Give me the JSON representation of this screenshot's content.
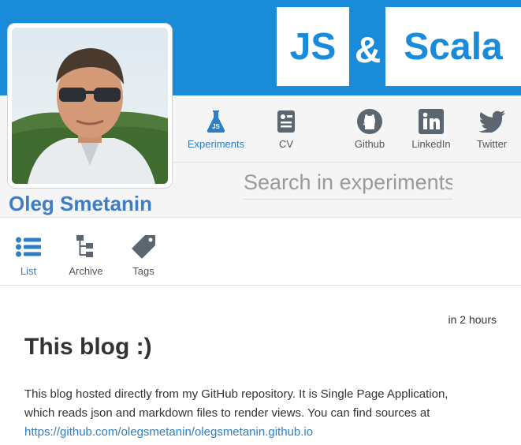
{
  "logo": {
    "part1": "JS",
    "amp": "&",
    "part2": "Scala"
  },
  "profile": {
    "name": "Oleg Smetanin"
  },
  "topnav": [
    {
      "label": "Experiments",
      "icon": "flask-icon",
      "active": true
    },
    {
      "label": "CV",
      "icon": "document-icon",
      "active": false
    },
    {
      "label": "Github",
      "icon": "github-icon",
      "active": false
    },
    {
      "label": "LinkedIn",
      "icon": "linkedin-icon",
      "active": false
    },
    {
      "label": "Twitter",
      "icon": "twitter-icon",
      "active": false
    }
  ],
  "search": {
    "placeholder": "Search in experiments",
    "value": ""
  },
  "subnav": [
    {
      "label": "List",
      "icon": "list-icon",
      "active": true
    },
    {
      "label": "Archive",
      "icon": "tree-icon",
      "active": false
    },
    {
      "label": "Tags",
      "icon": "tag-icon",
      "active": false
    }
  ],
  "post": {
    "time": "in 2 hours",
    "title": "This blog :)",
    "body_line1": "This blog hosted directly from my GitHub repository. It is Single Page Application,",
    "body_line2": "which reads json and markdown files to render views. You can find sources at",
    "link": "https://github.com/olegsmetanin/olegsmetanin.github.io"
  },
  "colors": {
    "brand": "#1a8bd9",
    "link": "#2d7ec3",
    "name": "#3e7dc3",
    "icon": "#5b6670"
  }
}
